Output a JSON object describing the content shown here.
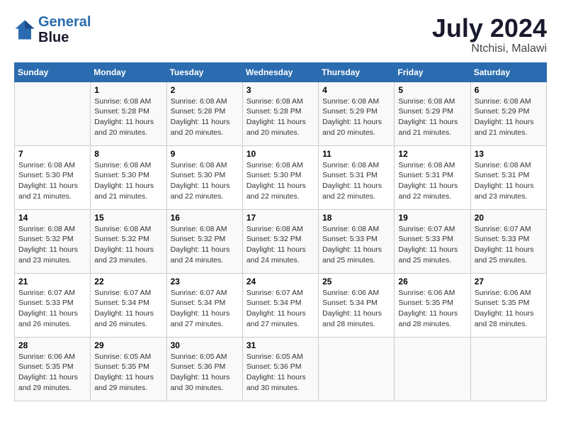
{
  "header": {
    "logo_line1": "General",
    "logo_line2": "Blue",
    "month": "July 2024",
    "location": "Ntchisi, Malawi"
  },
  "columns": [
    "Sunday",
    "Monday",
    "Tuesday",
    "Wednesday",
    "Thursday",
    "Friday",
    "Saturday"
  ],
  "weeks": [
    [
      {
        "day": "",
        "info": ""
      },
      {
        "day": "1",
        "info": "Sunrise: 6:08 AM\nSunset: 5:28 PM\nDaylight: 11 hours\nand 20 minutes."
      },
      {
        "day": "2",
        "info": "Sunrise: 6:08 AM\nSunset: 5:28 PM\nDaylight: 11 hours\nand 20 minutes."
      },
      {
        "day": "3",
        "info": "Sunrise: 6:08 AM\nSunset: 5:28 PM\nDaylight: 11 hours\nand 20 minutes."
      },
      {
        "day": "4",
        "info": "Sunrise: 6:08 AM\nSunset: 5:29 PM\nDaylight: 11 hours\nand 20 minutes."
      },
      {
        "day": "5",
        "info": "Sunrise: 6:08 AM\nSunset: 5:29 PM\nDaylight: 11 hours\nand 21 minutes."
      },
      {
        "day": "6",
        "info": "Sunrise: 6:08 AM\nSunset: 5:29 PM\nDaylight: 11 hours\nand 21 minutes."
      }
    ],
    [
      {
        "day": "7",
        "info": "Sunrise: 6:08 AM\nSunset: 5:30 PM\nDaylight: 11 hours\nand 21 minutes."
      },
      {
        "day": "8",
        "info": "Sunrise: 6:08 AM\nSunset: 5:30 PM\nDaylight: 11 hours\nand 21 minutes."
      },
      {
        "day": "9",
        "info": "Sunrise: 6:08 AM\nSunset: 5:30 PM\nDaylight: 11 hours\nand 22 minutes."
      },
      {
        "day": "10",
        "info": "Sunrise: 6:08 AM\nSunset: 5:30 PM\nDaylight: 11 hours\nand 22 minutes."
      },
      {
        "day": "11",
        "info": "Sunrise: 6:08 AM\nSunset: 5:31 PM\nDaylight: 11 hours\nand 22 minutes."
      },
      {
        "day": "12",
        "info": "Sunrise: 6:08 AM\nSunset: 5:31 PM\nDaylight: 11 hours\nand 22 minutes."
      },
      {
        "day": "13",
        "info": "Sunrise: 6:08 AM\nSunset: 5:31 PM\nDaylight: 11 hours\nand 23 minutes."
      }
    ],
    [
      {
        "day": "14",
        "info": "Sunrise: 6:08 AM\nSunset: 5:32 PM\nDaylight: 11 hours\nand 23 minutes."
      },
      {
        "day": "15",
        "info": "Sunrise: 6:08 AM\nSunset: 5:32 PM\nDaylight: 11 hours\nand 23 minutes."
      },
      {
        "day": "16",
        "info": "Sunrise: 6:08 AM\nSunset: 5:32 PM\nDaylight: 11 hours\nand 24 minutes."
      },
      {
        "day": "17",
        "info": "Sunrise: 6:08 AM\nSunset: 5:32 PM\nDaylight: 11 hours\nand 24 minutes."
      },
      {
        "day": "18",
        "info": "Sunrise: 6:08 AM\nSunset: 5:33 PM\nDaylight: 11 hours\nand 25 minutes."
      },
      {
        "day": "19",
        "info": "Sunrise: 6:07 AM\nSunset: 5:33 PM\nDaylight: 11 hours\nand 25 minutes."
      },
      {
        "day": "20",
        "info": "Sunrise: 6:07 AM\nSunset: 5:33 PM\nDaylight: 11 hours\nand 25 minutes."
      }
    ],
    [
      {
        "day": "21",
        "info": "Sunrise: 6:07 AM\nSunset: 5:33 PM\nDaylight: 11 hours\nand 26 minutes."
      },
      {
        "day": "22",
        "info": "Sunrise: 6:07 AM\nSunset: 5:34 PM\nDaylight: 11 hours\nand 26 minutes."
      },
      {
        "day": "23",
        "info": "Sunrise: 6:07 AM\nSunset: 5:34 PM\nDaylight: 11 hours\nand 27 minutes."
      },
      {
        "day": "24",
        "info": "Sunrise: 6:07 AM\nSunset: 5:34 PM\nDaylight: 11 hours\nand 27 minutes."
      },
      {
        "day": "25",
        "info": "Sunrise: 6:06 AM\nSunset: 5:34 PM\nDaylight: 11 hours\nand 28 minutes."
      },
      {
        "day": "26",
        "info": "Sunrise: 6:06 AM\nSunset: 5:35 PM\nDaylight: 11 hours\nand 28 minutes."
      },
      {
        "day": "27",
        "info": "Sunrise: 6:06 AM\nSunset: 5:35 PM\nDaylight: 11 hours\nand 28 minutes."
      }
    ],
    [
      {
        "day": "28",
        "info": "Sunrise: 6:06 AM\nSunset: 5:35 PM\nDaylight: 11 hours\nand 29 minutes."
      },
      {
        "day": "29",
        "info": "Sunrise: 6:05 AM\nSunset: 5:35 PM\nDaylight: 11 hours\nand 29 minutes."
      },
      {
        "day": "30",
        "info": "Sunrise: 6:05 AM\nSunset: 5:36 PM\nDaylight: 11 hours\nand 30 minutes."
      },
      {
        "day": "31",
        "info": "Sunrise: 6:05 AM\nSunset: 5:36 PM\nDaylight: 11 hours\nand 30 minutes."
      },
      {
        "day": "",
        "info": ""
      },
      {
        "day": "",
        "info": ""
      },
      {
        "day": "",
        "info": ""
      }
    ]
  ]
}
